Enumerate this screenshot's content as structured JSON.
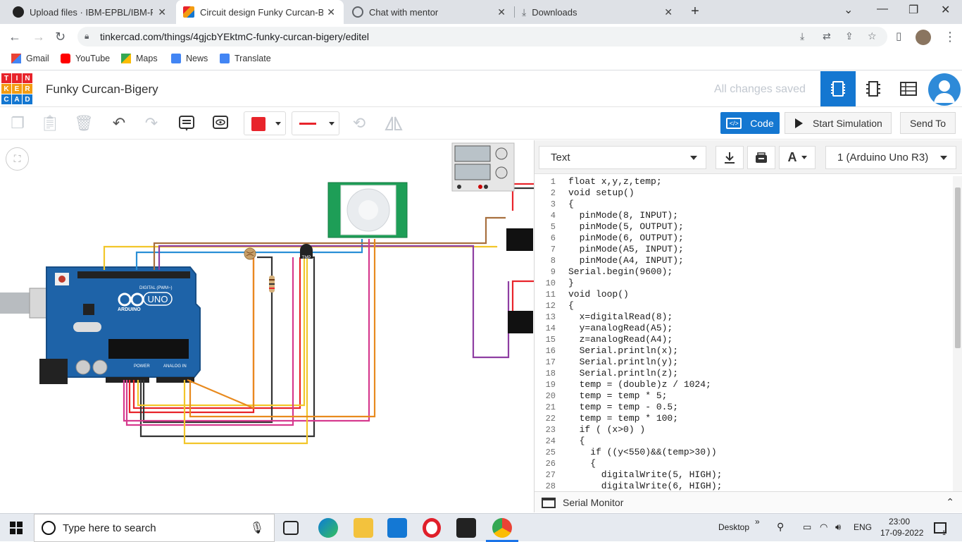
{
  "browser": {
    "tabs": [
      {
        "title": "Upload files · IBM-EPBL/IBM-Proj",
        "icon": "github-icon",
        "active": false
      },
      {
        "title": "Circuit design Funky Curcan-Bige",
        "icon": "tinkercad-icon",
        "active": true
      },
      {
        "title": "Chat with mentor",
        "icon": "globe-icon",
        "active": false
      },
      {
        "title": "Downloads",
        "icon": "download-icon",
        "active": false
      }
    ],
    "url": "tinkercad.com/things/4gjcbYEktmC-funky-curcan-bigery/editel",
    "bookmarks": [
      "Gmail",
      "YouTube",
      "Maps",
      "News",
      "Translate"
    ]
  },
  "header": {
    "logo_letters": [
      "T",
      "I",
      "N",
      "K",
      "E",
      "R",
      "C",
      "A",
      "D"
    ],
    "design_title": "Funky Curcan-Bigery",
    "save_status": "All changes saved"
  },
  "toolbar": {
    "code_label": "Code",
    "start_sim_label": "Start Simulation",
    "send_to_label": "Send To",
    "color_swatch": "#e8242b"
  },
  "code_panel": {
    "mode": "Text",
    "board": "1 (Arduino Uno R3)",
    "serial_monitor_label": "Serial Monitor",
    "lines": [
      "float x,y,z,temp;",
      "void setup()",
      "{",
      "  pinMode(8, INPUT);",
      "  pinMode(5, OUTPUT);",
      "  pinMode(6, OUTPUT);",
      "  pinMode(A5, INPUT);",
      "  pinMode(A4, INPUT);",
      "Serial.begin(9600);",
      "}",
      "void loop()",
      "{",
      "  x=digitalRead(8);",
      "  y=analogRead(A5);",
      "  z=analogRead(A4);",
      "  Serial.println(x);",
      "  Serial.println(y);",
      "  Serial.println(z);",
      "  temp = (double)z / 1024;",
      "  temp = temp * 5;",
      "  temp = temp - 0.5;",
      "  temp = temp * 100;",
      "  if ( (x>0) )",
      "  {",
      "    if ((y<550)&&(temp>30))",
      "    {",
      "      digitalWrite(5, HIGH);",
      "      digitalWrite(6, HIGH);"
    ]
  },
  "circuit": {
    "board_label": "ARDUINO",
    "board_model": "UNO",
    "digital_label": "DIGITAL (PWM~)",
    "power_label": "POWER",
    "analog_label": "ANALOG IN",
    "sensor_label": "TMP"
  },
  "taskbar": {
    "search_placeholder": "Type here to search",
    "desktop_label": "Desktop",
    "lang": "ENG",
    "time": "23:00",
    "date": "17-09-2022",
    "notification_count": "1"
  }
}
